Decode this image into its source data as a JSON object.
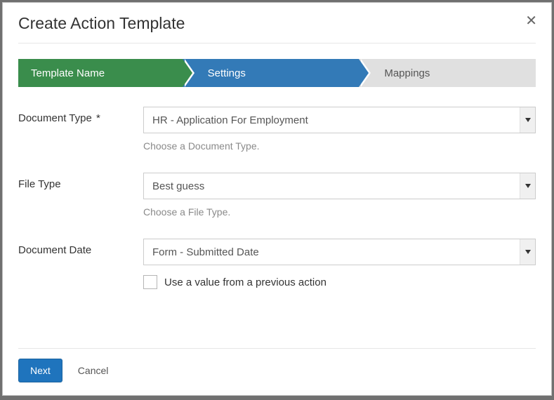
{
  "modal": {
    "title": "Create Action Template"
  },
  "wizard": {
    "steps": [
      {
        "label": "Template Name"
      },
      {
        "label": "Settings"
      },
      {
        "label": "Mappings"
      }
    ]
  },
  "fields": {
    "documentType": {
      "label": "Document Type",
      "required_mark": "*",
      "value": "HR - Application For Employment",
      "hint": "Choose a Document Type."
    },
    "fileType": {
      "label": "File Type",
      "value": "Best guess",
      "hint": "Choose a File Type."
    },
    "documentDate": {
      "label": "Document Date",
      "value": "Form - Submitted Date",
      "checkbox_label": "Use a value from a previous action"
    }
  },
  "footer": {
    "next": "Next",
    "cancel": "Cancel"
  }
}
